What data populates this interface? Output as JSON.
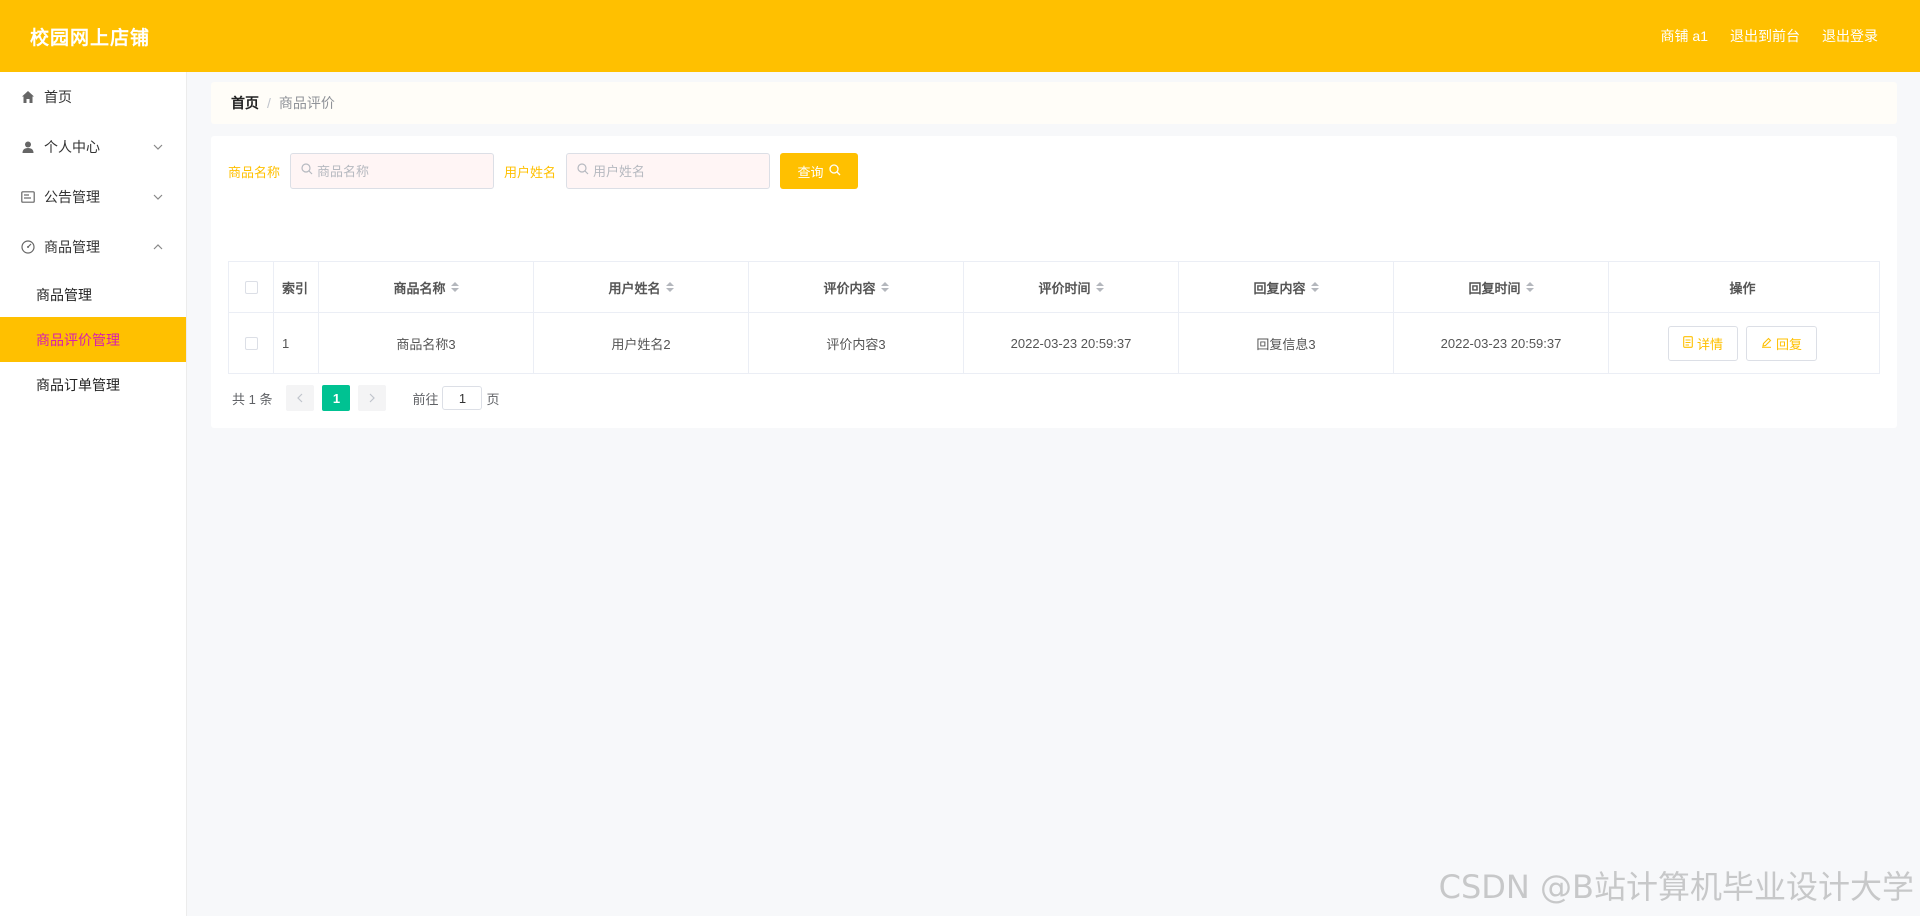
{
  "header": {
    "brand": "校园网上店铺",
    "links": [
      "商铺 a1",
      "退出到前台",
      "退出登录"
    ]
  },
  "sidebar": {
    "items": [
      {
        "label": "首页",
        "icon": "home-icon"
      },
      {
        "label": "个人中心",
        "icon": "user-icon",
        "expandable": true
      },
      {
        "label": "公告管理",
        "icon": "notice-icon",
        "expandable": true
      },
      {
        "label": "商品管理",
        "icon": "dashboard-icon",
        "expandable": true,
        "expanded": true
      }
    ],
    "subitems": [
      {
        "label": "商品管理"
      },
      {
        "label": "商品评价管理",
        "active": true
      },
      {
        "label": "商品订单管理"
      }
    ]
  },
  "breadcrumb": {
    "home": "首页",
    "separator": "/",
    "current": "商品评价"
  },
  "search": {
    "product_label": "商品名称",
    "product_placeholder": "商品名称",
    "user_label": "用户姓名",
    "user_placeholder": "用户姓名",
    "query_label": "查询"
  },
  "table": {
    "headers": [
      "索引",
      "商品名称",
      "用户姓名",
      "评价内容",
      "评价时间",
      "回复内容",
      "回复时间",
      "操作"
    ],
    "rows": [
      {
        "index": "1",
        "product": "商品名称3",
        "user": "用户姓名2",
        "review": "评价内容3",
        "review_time": "2022-03-23 20:59:37",
        "reply": "回复信息3",
        "reply_time": "2022-03-23 20:59:37"
      }
    ],
    "actions": {
      "detail": "详情",
      "reply": "回复"
    }
  },
  "pagination": {
    "total": "共 1 条",
    "current_page": "1",
    "goto_prefix": "前往",
    "goto_value": "1",
    "goto_suffix": "页"
  },
  "watermark": "CSDN @B站计算机毕业设计大学",
  "colors": {
    "accent": "#ffc000",
    "page_active": "#00c292",
    "active_text": "#d81eb0"
  }
}
